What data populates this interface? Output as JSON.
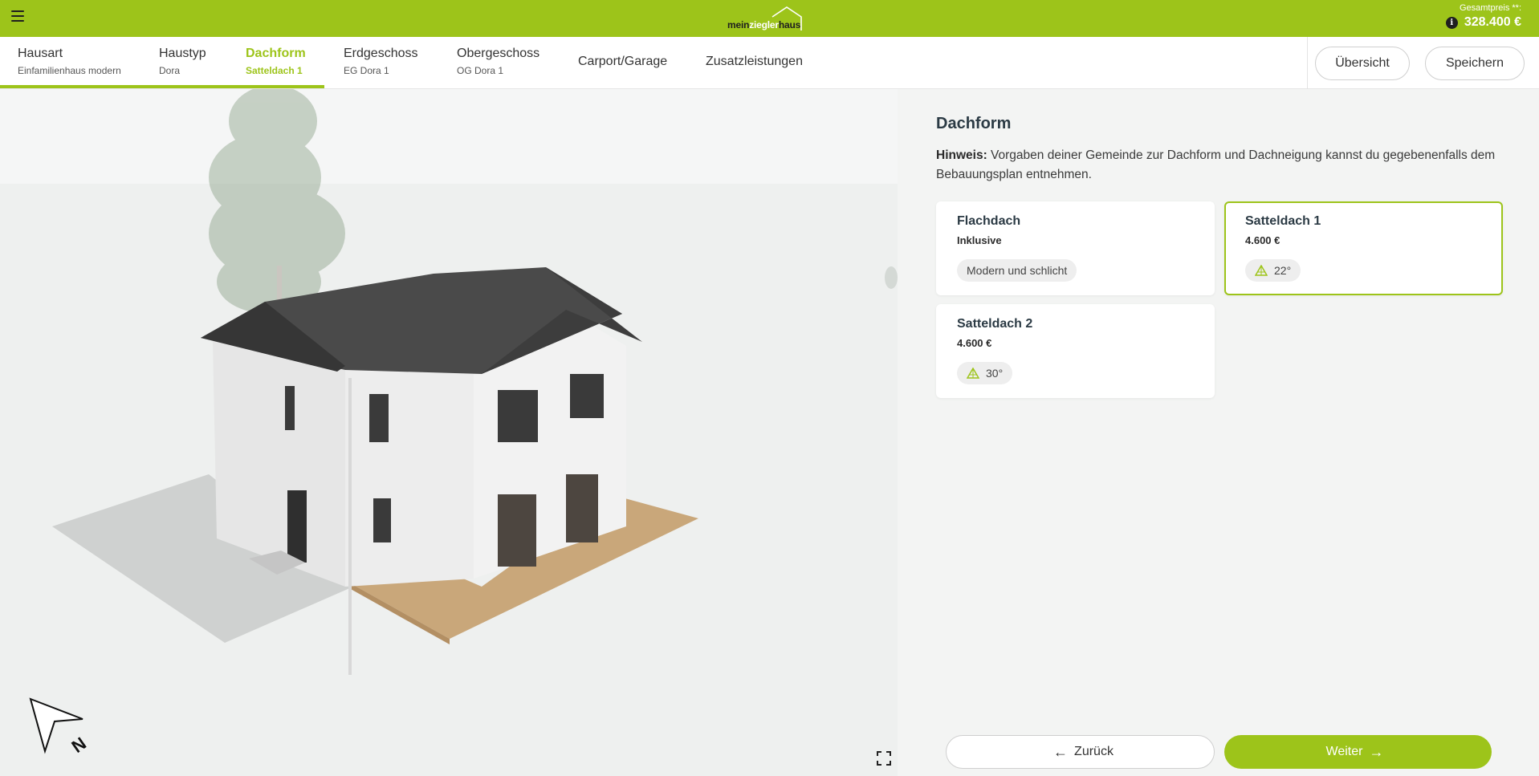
{
  "header": {
    "logo": {
      "part1": "mein",
      "part2": "ziegler",
      "part3": "haus"
    },
    "price_label": "Gesamtpreis **:",
    "price_value": "328.400 €",
    "info_icon_glyph": "i"
  },
  "nav": {
    "items": [
      {
        "title": "Hausart",
        "sub": "Einfamilienhaus modern"
      },
      {
        "title": "Haustyp",
        "sub": "Dora"
      },
      {
        "title": "Dachform",
        "sub": "Satteldach 1"
      },
      {
        "title": "Erdgeschoss",
        "sub": "EG Dora 1"
      },
      {
        "title": "Obergeschoss",
        "sub": "OG Dora 1"
      },
      {
        "title": "Carport/Garage"
      },
      {
        "title": "Zusatzleistungen"
      }
    ],
    "overview_button": "Übersicht",
    "save_button": "Speichern"
  },
  "panel": {
    "title": "Dachform",
    "hint_label": "Hinweis:",
    "hint_text": "Vorgaben deiner Gemeinde zur Dachform und Dachneigung kannst du gegebenenfalls dem Bebauungsplan entnehmen.",
    "options": [
      {
        "title": "Flachdach",
        "price": "Inklusive",
        "tag": "Modern und schlicht",
        "selected": false
      },
      {
        "title": "Satteldach 1",
        "price": "4.600 €",
        "tag": "22°",
        "tag_icon": "roof-pitch-icon",
        "selected": true
      },
      {
        "title": "Satteldach 2",
        "price": "4.600 €",
        "tag": "30°",
        "tag_icon": "roof-pitch-icon",
        "selected": false
      }
    ],
    "back_button": "Zurück",
    "next_button": "Weiter"
  },
  "colors": {
    "brand": "#9dc41a",
    "text_dark": "#2b3a44",
    "background": "#f3f4f3"
  }
}
